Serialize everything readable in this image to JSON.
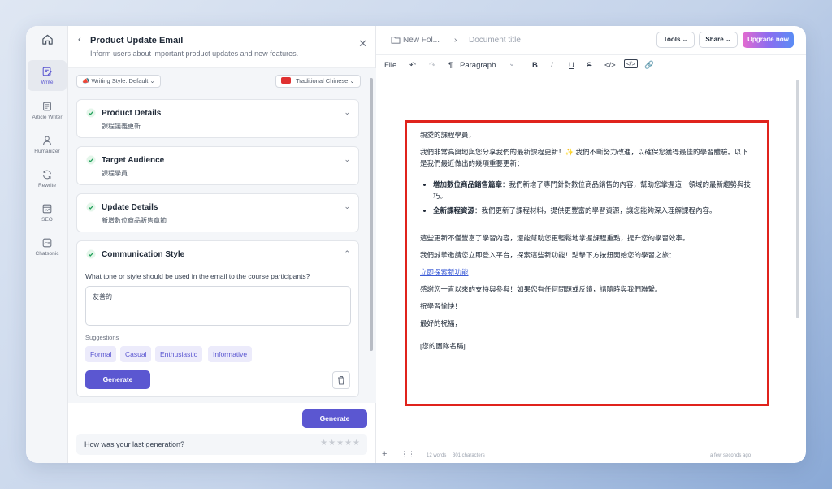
{
  "rail": {
    "items": [
      {
        "label": "Write"
      },
      {
        "label": "Article Writer"
      },
      {
        "label": "Humanizer"
      },
      {
        "label": "Rewrite"
      },
      {
        "label": "SEO"
      },
      {
        "label": "Chatsonic"
      }
    ]
  },
  "panel": {
    "title": "Product Update Email",
    "subtitle": "Inform users about important product updates and new features.",
    "writing_style": "Writing Style: Default",
    "language": "Traditional Chinese",
    "cards": [
      {
        "title": "Product Details",
        "value": "課程議義更新"
      },
      {
        "title": "Target Audience",
        "value": "課程學員"
      },
      {
        "title": "Update Details",
        "value": "新增數位商品販售章節"
      }
    ],
    "comm": {
      "title": "Communication Style",
      "question": "What tone or style should be used in the email to the course participants?",
      "answer": "友善的",
      "suggestions_label": "Suggestions",
      "suggestions": [
        "Formal",
        "Casual",
        "Enthusiastic",
        "Informative"
      ],
      "generate_label": "Generate"
    },
    "footer_generate_label": "Generate",
    "feedback_question": "How was your last generation?"
  },
  "editor": {
    "folder": "New Fol...",
    "doc_title": "Document title",
    "tools_label": "Tools",
    "share_label": "Share",
    "upgrade_label": "Upgrade now",
    "toolbar": {
      "file": "File",
      "paragraph": "Paragraph"
    },
    "document": {
      "greeting": "親愛的課程學員，",
      "intro_1": "我們非常高興地與您分享我們的最新課程更新！",
      "intro_2": " 我們不斷努力改進，以確保您獲得最佳的學習體驗。以下是我們最近做出的幾項重要更新：",
      "bullets": [
        {
          "bold": "增加數位商品銷售篇章",
          "text": "：我們新增了專門針對數位商品銷售的內容，幫助您掌握這一領域的最新趨勢與技巧。"
        },
        {
          "bold": "全新課程資源",
          "text": "：我們更新了課程材料，提供更豐富的學習資源，讓您能夠深入理解課程內容。"
        }
      ],
      "para_1": "這些更新不僅豐富了學習內容，還能幫助您更輕鬆地掌握課程重點，提升您的學習效率。",
      "para_2": "我們誠摯邀請您立即登入平台，探索這些新功能！點擊下方按鈕開始您的學習之旅：",
      "link": "立即探索新功能",
      "para_3": "感謝您一直以來的支持與參與！如果您有任何問題或反饋，請隨時與我們聯繫。",
      "para_4": "祝學習愉快！",
      "para_5": "最好的祝福，",
      "signature": "[您的團隊名稱]"
    },
    "status": {
      "words": "12 words",
      "chars": "301 characters",
      "saved": "a few seconds ago"
    }
  },
  "colors": {
    "accent": "#5b57d1",
    "highlight_border": "#e0231c",
    "check_green": "#22a05a"
  }
}
